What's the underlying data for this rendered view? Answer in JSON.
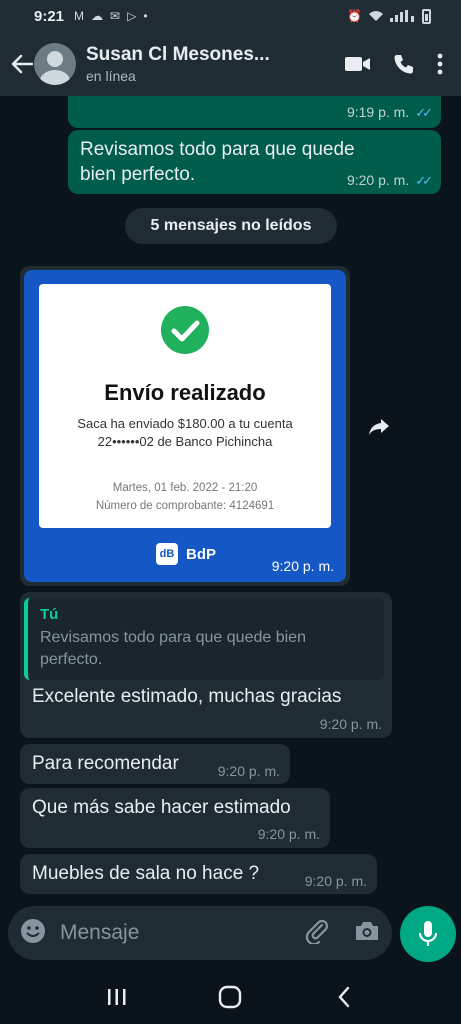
{
  "status_bar": {
    "time": "9:21",
    "icons": [
      "gmail-icon",
      "cloud-icon",
      "mail-icon",
      "play-icon",
      "dot-icon",
      "alarm-icon",
      "wifi-icon",
      "signal-icon",
      "battery-icon"
    ]
  },
  "header": {
    "contact_name": "Susan Cl Mesones...",
    "status": "en línea"
  },
  "messages": {
    "m1": {
      "time": "9:19 p. m."
    },
    "m2": {
      "text_line1": "Revisamos todo para que quede",
      "text_line2": "bien perfecto.",
      "time": "9:20 p. m."
    },
    "unread_label": "5 mensajes no leídos",
    "image": {
      "title": "Envío realizado",
      "line1": "Saca ha enviado $180.00 a tu cuenta",
      "line2": "22••••••02 de Banco Pichincha",
      "date": "Martes, 01 feb. 2022 - 21:20",
      "receipt_number": "Número de comprobante: 4124691",
      "brand": "BdP",
      "time": "9:20 p. m."
    },
    "reply": {
      "quote_author": "Tú",
      "quote_text_line1": "Revisamos todo para que quede bien",
      "quote_text_line2": "perfecto.",
      "text": "Excelente estimado, muchas gracias",
      "time": "9:20 p. m."
    },
    "m4": {
      "text": "Para recomendar",
      "time": "9:20 p. m."
    },
    "m5": {
      "text": "Que más sabe hacer estimado",
      "time": "9:20 p. m."
    },
    "m6": {
      "text": "Muebles de sala no hace ?",
      "time": "9:20 p. m."
    }
  },
  "input": {
    "placeholder": "Mensaje"
  },
  "colors": {
    "outgoing_bubble": "#005c4b",
    "incoming_bubble": "#1f2c34",
    "accent": "#00a884",
    "read_ticks": "#53bdeb",
    "receipt_blue": "#1558c5"
  }
}
